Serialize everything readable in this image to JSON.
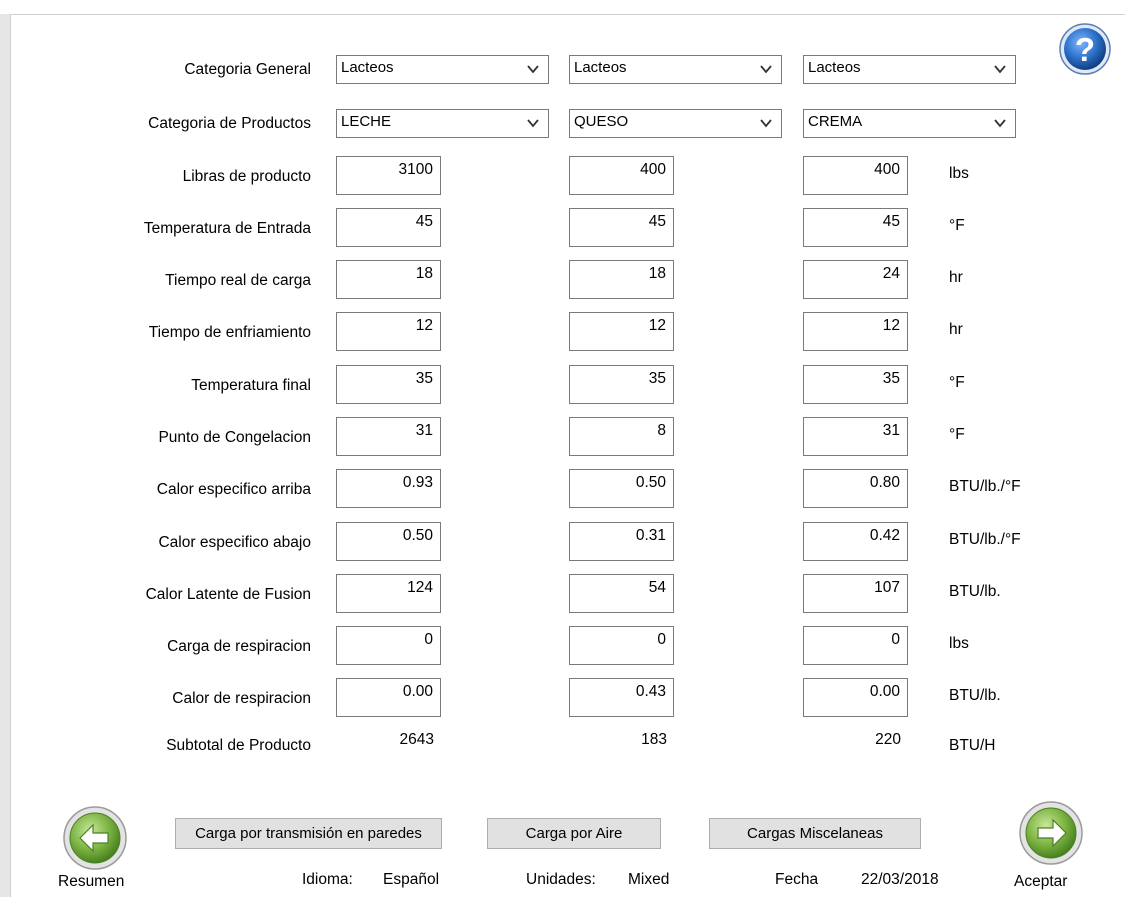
{
  "help": {
    "icon": "question-mark-icon"
  },
  "selectors": {
    "general": {
      "label": "Categoria General",
      "values": [
        "Lacteos",
        "Lacteos",
        "Lacteos"
      ]
    },
    "products": {
      "label": "Categoria de Productos",
      "values": [
        "LECHE",
        "QUESO",
        "CREMA"
      ]
    }
  },
  "rows": [
    {
      "label": "Libras de producto",
      "values": [
        "3100",
        "400",
        "400"
      ],
      "unit": "lbs"
    },
    {
      "label": "Temperatura de Entrada",
      "values": [
        "45",
        "45",
        "45"
      ],
      "unit": "°F"
    },
    {
      "label": "Tiempo real de carga",
      "values": [
        "18",
        "18",
        "24"
      ],
      "unit": "hr"
    },
    {
      "label": "Tiempo de enfriamiento",
      "values": [
        "12",
        "12",
        "12"
      ],
      "unit": "hr"
    },
    {
      "label": "Temperatura final",
      "values": [
        "35",
        "35",
        "35"
      ],
      "unit": "°F"
    },
    {
      "label": "Punto de Congelacion",
      "values": [
        "31",
        "8",
        "31"
      ],
      "unit": "°F"
    },
    {
      "label": "Calor especifico arriba",
      "values": [
        "0.93",
        "0.50",
        "0.80"
      ],
      "unit": "BTU/lb./°F"
    },
    {
      "label": "Calor especifico abajo",
      "values": [
        "0.50",
        "0.31",
        "0.42"
      ],
      "unit": "BTU/lb./°F"
    },
    {
      "label": "Calor Latente de Fusion",
      "values": [
        "124",
        "54",
        "107"
      ],
      "unit": "BTU/lb."
    },
    {
      "label": "Carga de respiracion",
      "values": [
        "0",
        "0",
        "0"
      ],
      "unit": "lbs"
    },
    {
      "label": "Calor de respiracion",
      "values": [
        "0.00",
        "0.43",
        "0.00"
      ],
      "unit": "BTU/lb."
    }
  ],
  "subtotal": {
    "label": "Subtotal de Producto",
    "values": [
      "2643",
      "183",
      "220"
    ],
    "unit": "BTU/H"
  },
  "buttons": {
    "walls": "Carga por transmisión en paredes",
    "air": "Carga por Aire",
    "misc": "Cargas Miscelaneas"
  },
  "nav": {
    "back_label": "Resumen",
    "forward_label": "Aceptar",
    "back_icon": "arrow-left-icon",
    "forward_icon": "arrow-right-icon"
  },
  "footer": {
    "language_label": "Idioma:",
    "language_value": "Español",
    "units_label": "Unidades:",
    "units_value": "Mixed",
    "date_label": "Fecha",
    "date_value": "22/03/2018"
  },
  "colors": {
    "icon_green": "#7cb342",
    "help_blue": "#1f5fa8"
  }
}
